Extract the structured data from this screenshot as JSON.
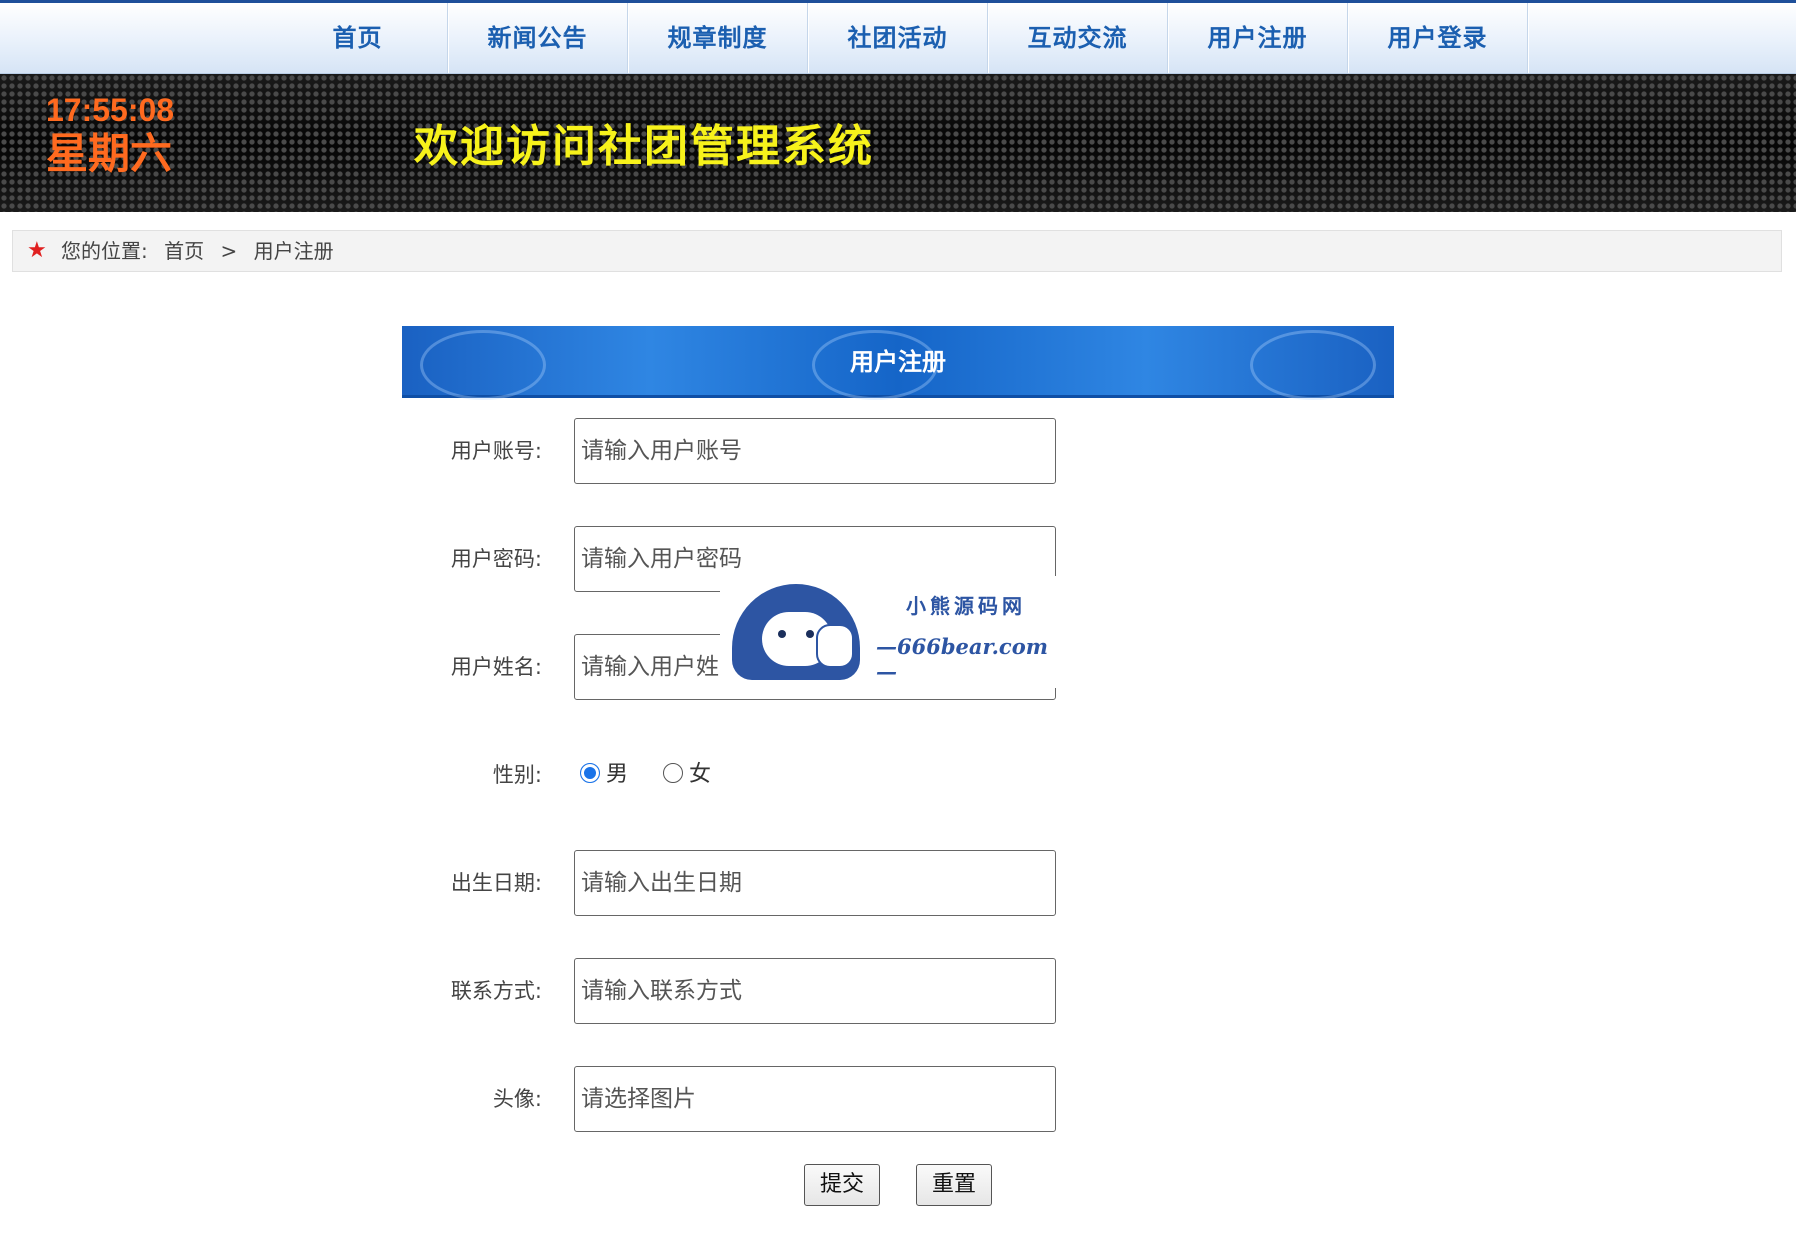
{
  "nav": {
    "items": [
      {
        "label": "首页"
      },
      {
        "label": "新闻公告"
      },
      {
        "label": "规章制度"
      },
      {
        "label": "社团活动"
      },
      {
        "label": "互动交流"
      },
      {
        "label": "用户注册"
      },
      {
        "label": "用户登录"
      }
    ]
  },
  "banner": {
    "time": "17:55:08",
    "weekday": "星期六",
    "welcome": "欢迎访问社团管理系统"
  },
  "breadcrumb": {
    "prefix": "您的位置:",
    "home": "首页",
    "separator": ">",
    "current": "用户注册"
  },
  "form": {
    "title": "用户注册",
    "fields": [
      {
        "label": "用户账号:",
        "placeholder": "请输入用户账号"
      },
      {
        "label": "用户密码:",
        "placeholder": "请输入用户密码"
      },
      {
        "label": "用户姓名:",
        "placeholder": "请输入用户姓名"
      },
      {
        "label": "出生日期:",
        "placeholder": "请输入出生日期"
      },
      {
        "label": "联系方式:",
        "placeholder": "请输入联系方式"
      },
      {
        "label": "头像:",
        "placeholder": "请选择图片"
      }
    ],
    "gender": {
      "label": "性别:",
      "options": [
        {
          "label": "男",
          "selected": true
        },
        {
          "label": "女",
          "selected": false
        }
      ]
    },
    "submit_label": "提交",
    "reset_label": "重置"
  },
  "watermark": {
    "name": "小熊源码网",
    "site": "—666bear.com—"
  },
  "colors": {
    "nav_text": "#1b5fb0",
    "clock": "#ff6a1f",
    "welcome": "#f7f21b",
    "panel": "#1a61c2",
    "star": "#e02020"
  }
}
